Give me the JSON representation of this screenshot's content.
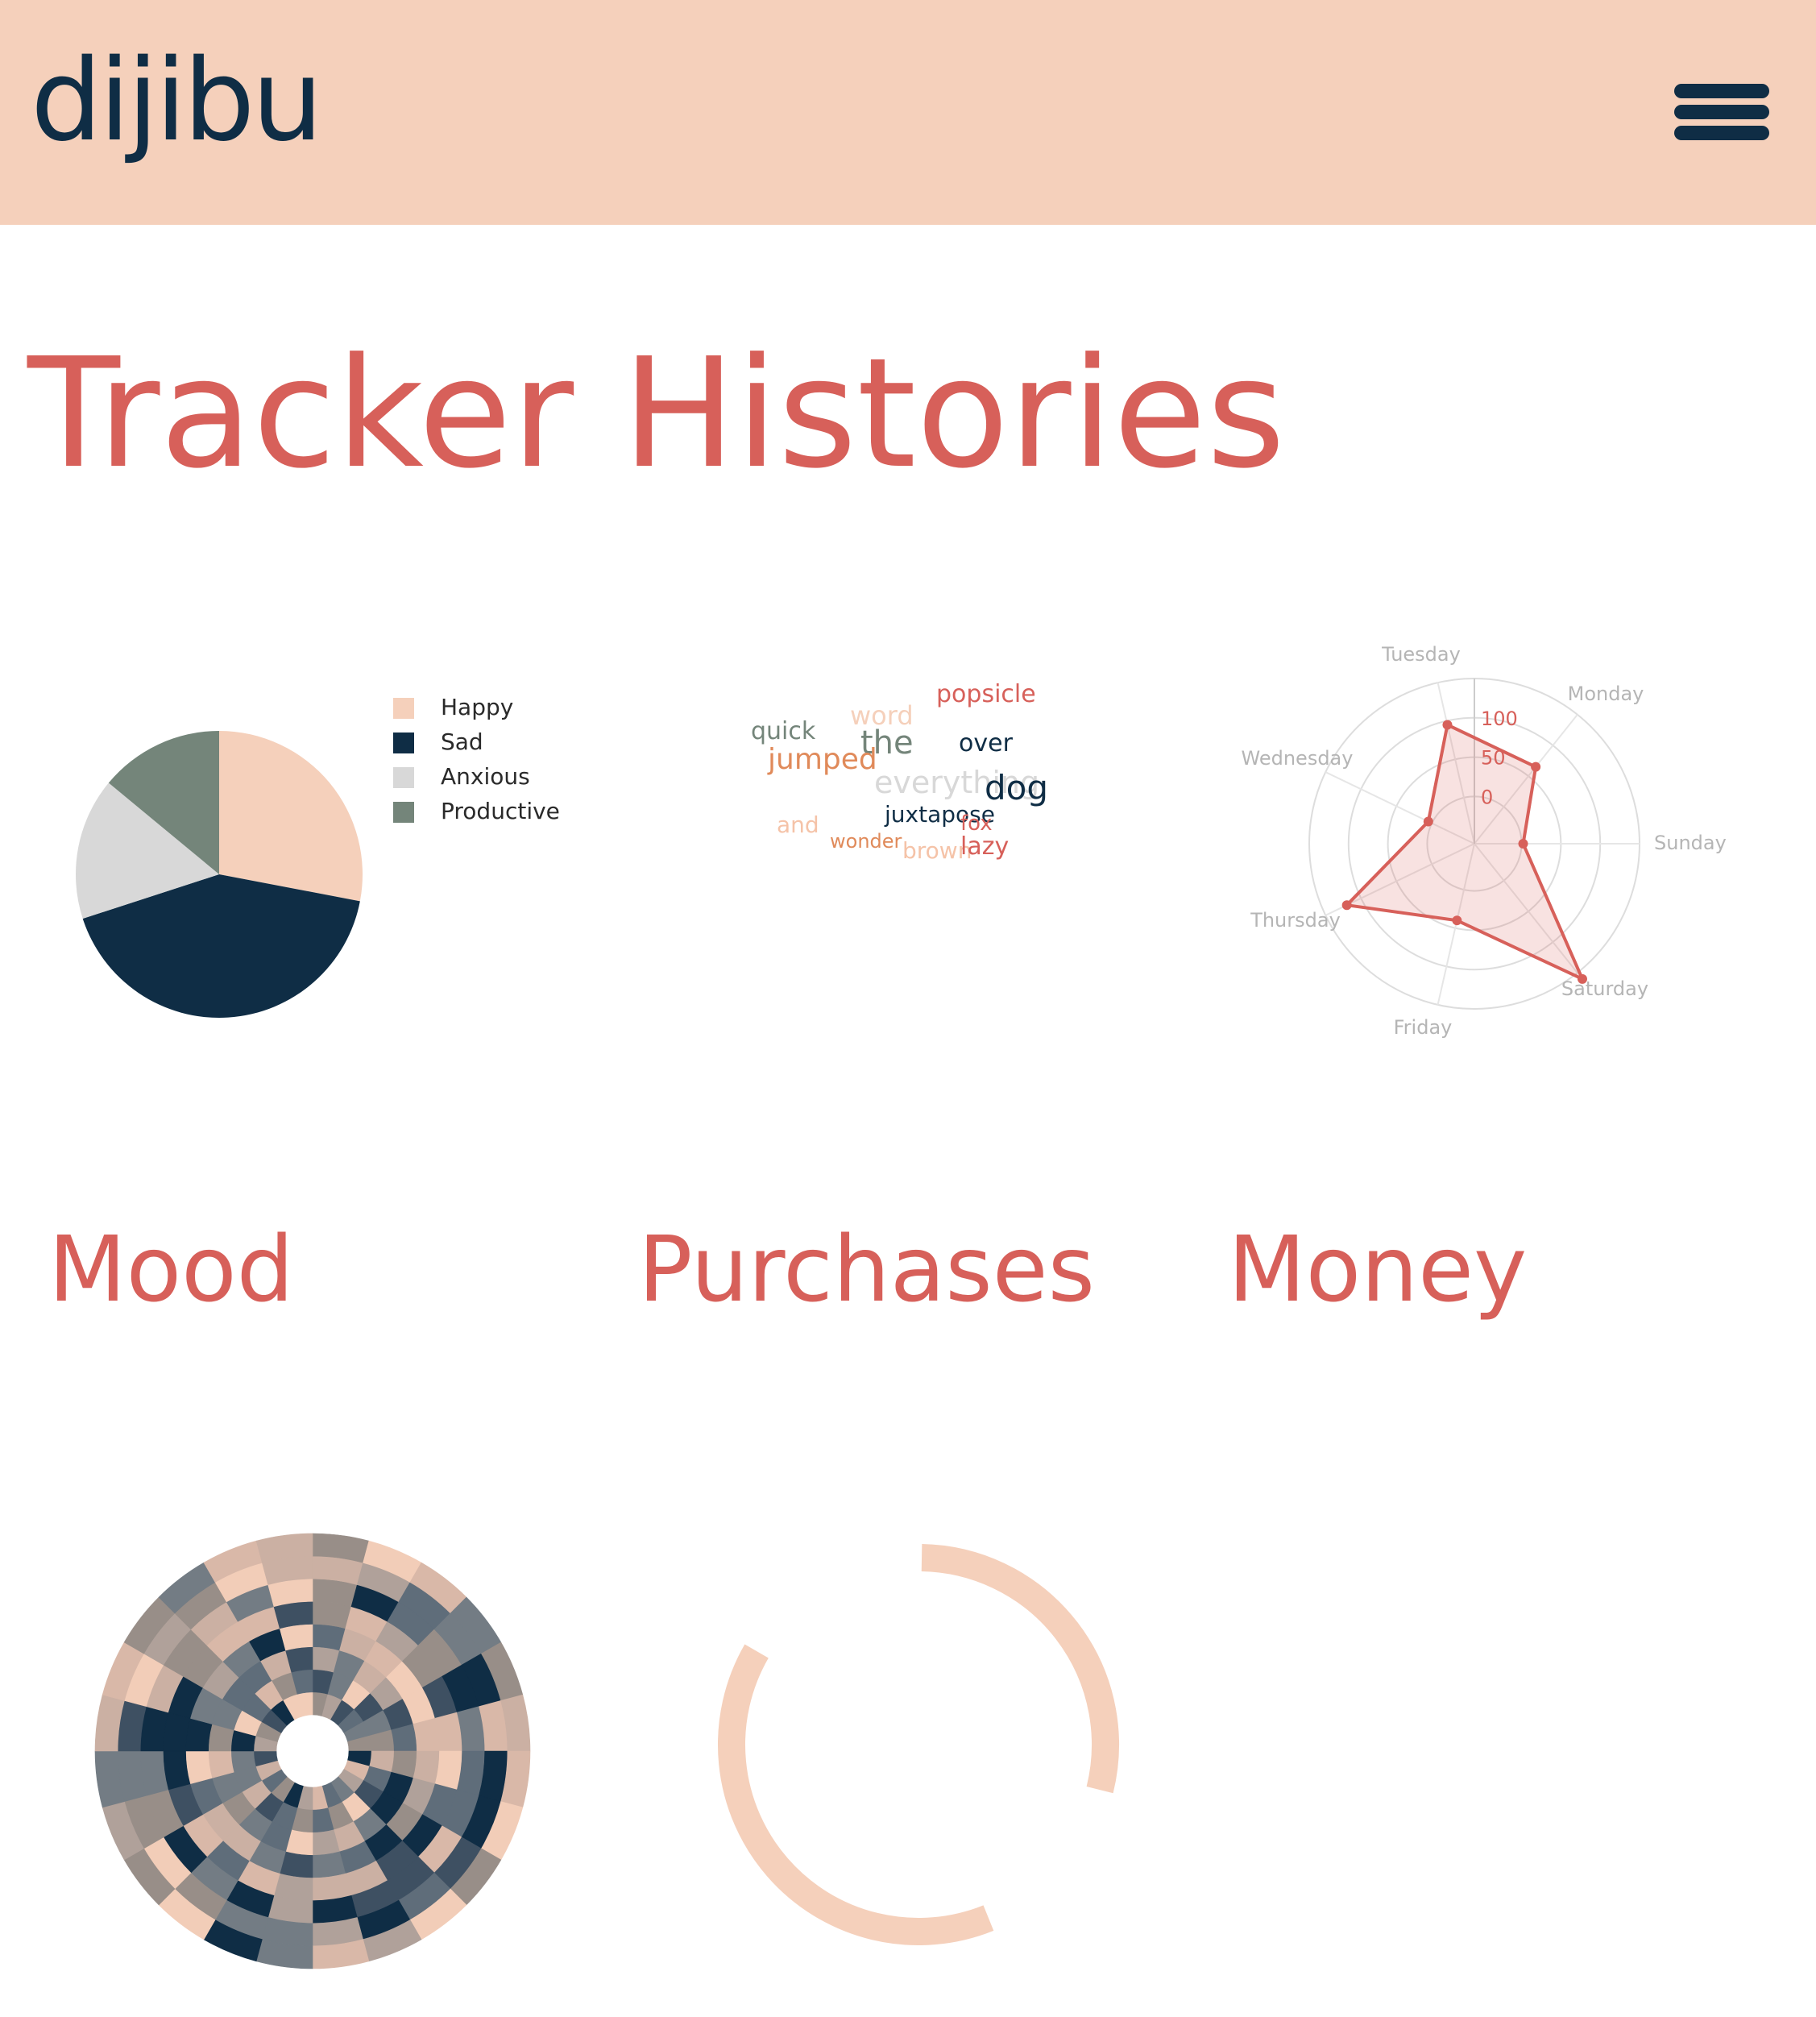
{
  "header": {
    "logo": "dijibu",
    "menu_icon": "hamburger-menu-icon",
    "bg": "#f5d0bb"
  },
  "main": {
    "title": "Tracker Histories",
    "sections": [
      {
        "label": "Mood"
      },
      {
        "label": "Purchases"
      },
      {
        "label": "Money"
      }
    ]
  },
  "colors": {
    "accent": "#d7605a",
    "navy": "#0f2d45",
    "peach": "#f5d0bb",
    "sage": "#74857a",
    "grey": "#d8d8d8"
  },
  "chart_data": [
    {
      "type": "pie",
      "categories": [
        "Happy",
        "Sad",
        "Anxious",
        "Productive"
      ],
      "values": [
        28,
        42,
        16,
        14
      ],
      "colors": [
        "#f5d0bb",
        "#0f2d45",
        "#d8d8d8",
        "#74857a"
      ],
      "legend": "right"
    },
    {
      "type": "wordcloud",
      "words": [
        {
          "text": "popsicle",
          "color": "#d7605a"
        },
        {
          "text": "word",
          "color": "#f5d0bb"
        },
        {
          "text": "quick",
          "color": "#74857a"
        },
        {
          "text": "the",
          "color": "#74857a"
        },
        {
          "text": "over",
          "color": "#0f2d45"
        },
        {
          "text": "jumped",
          "color": "#e08a5a"
        },
        {
          "text": "everything",
          "color": "#d8d8d8"
        },
        {
          "text": "dog",
          "color": "#0f2d45"
        },
        {
          "text": "juxtapose",
          "color": "#0f2d45"
        },
        {
          "text": "fox",
          "color": "#d7605a"
        },
        {
          "text": "and",
          "color": "#f5c3a8"
        },
        {
          "text": "wonder",
          "color": "#e08a5a"
        },
        {
          "text": "brown",
          "color": "#f5c3a8"
        },
        {
          "text": "lazy",
          "color": "#d7605a"
        }
      ]
    },
    {
      "type": "radar",
      "categories": [
        "Sunday",
        "Monday",
        "Tuesday",
        "Wednesday",
        "Thursday",
        "Friday",
        "Saturday"
      ],
      "values": [
        2,
        65,
        95,
        5,
        120,
        40,
        160
      ],
      "ticks": [
        "0",
        "50",
        "100"
      ],
      "range": [
        -60,
        150
      ],
      "color": "#d7605a"
    },
    {
      "type": "heatmap",
      "rings": 8,
      "sectors": 24
    },
    {
      "type": "pie",
      "categories": [
        "Purchases"
      ],
      "values": [
        75
      ],
      "colors": [
        "#f5d0bb"
      ]
    }
  ]
}
